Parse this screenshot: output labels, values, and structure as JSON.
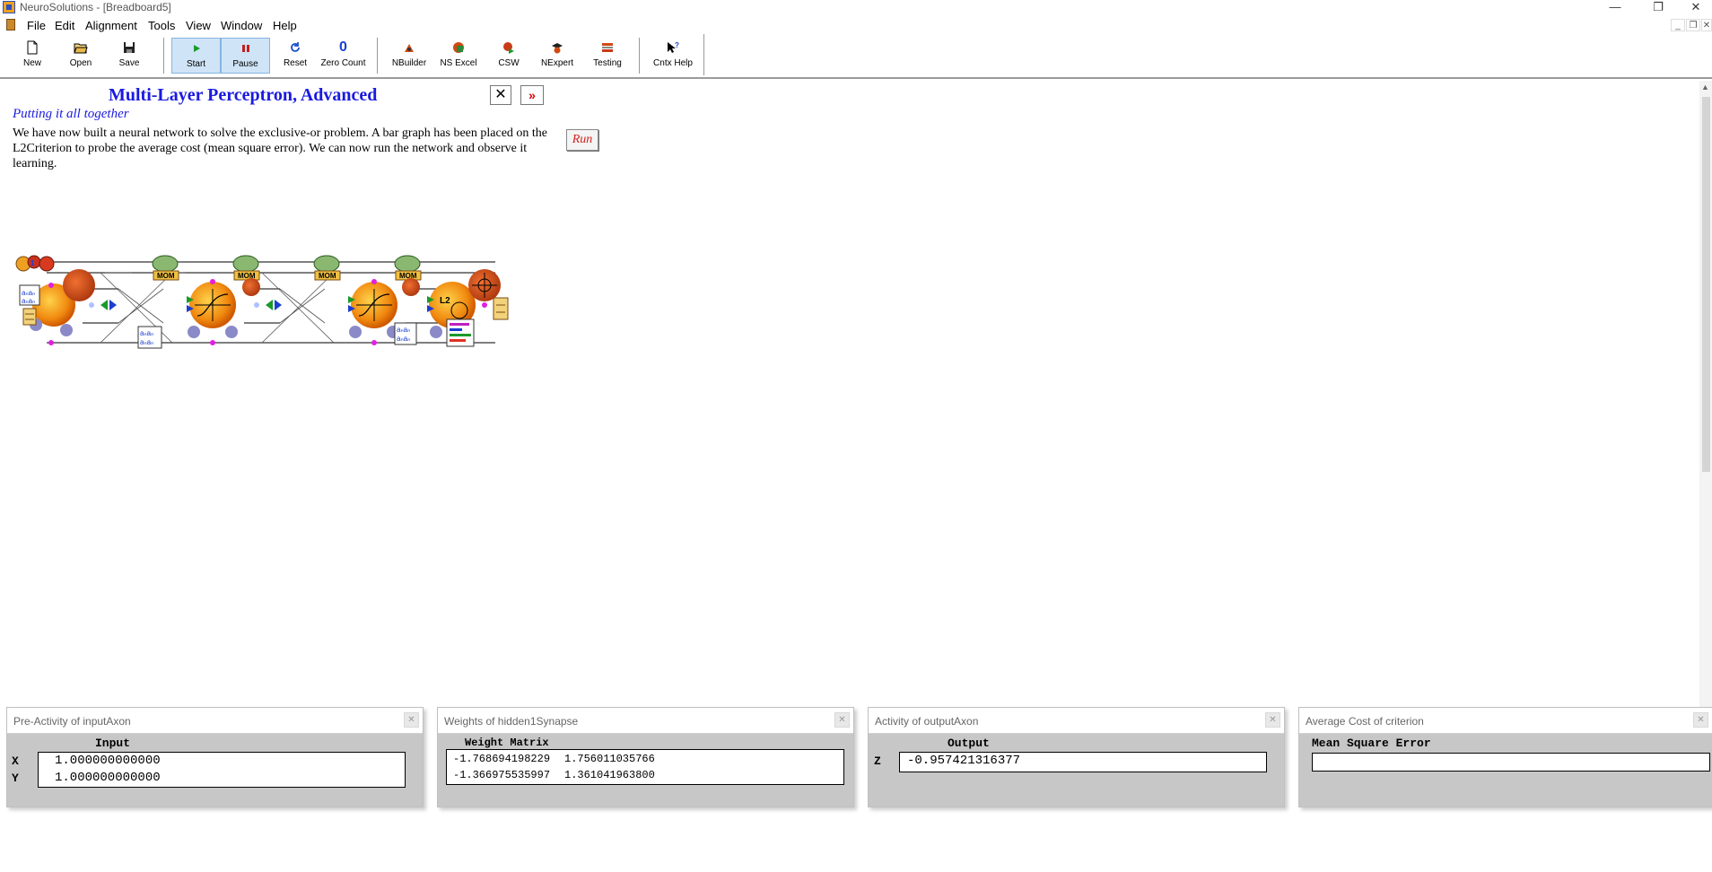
{
  "window": {
    "title": "NeuroSolutions - [Breadboard5]",
    "minimize": "—",
    "restore": "❐",
    "close": "✕"
  },
  "menu": {
    "items": [
      "File",
      "Edit",
      "Alignment",
      "Tools",
      "View",
      "Window",
      "Help"
    ]
  },
  "toolbar": {
    "buttons": [
      {
        "label": "New",
        "icon": "new-document-icon"
      },
      {
        "label": "Open",
        "icon": "open-folder-icon"
      },
      {
        "label": "Save",
        "icon": "save-disk-icon"
      },
      {
        "label": "Start",
        "icon": "play-icon"
      },
      {
        "label": "Pause",
        "icon": "pause-icon"
      },
      {
        "label": "Reset",
        "icon": "reset-icon"
      },
      {
        "label": "Zero Count",
        "icon": "zero-count-icon",
        "glyph": "0"
      },
      {
        "label": "NBuilder",
        "icon": "nbuilder-icon"
      },
      {
        "label": "NS Excel",
        "icon": "ns-excel-icon"
      },
      {
        "label": "CSW",
        "icon": "csw-icon"
      },
      {
        "label": "NExpert",
        "icon": "nexpert-icon"
      },
      {
        "label": "Testing",
        "icon": "testing-icon"
      },
      {
        "label": "Cntx Help",
        "icon": "context-help-icon"
      }
    ]
  },
  "document": {
    "title": "Multi-Layer Perceptron, Advanced",
    "subtitle": "Putting it all together",
    "body": "We have now built a neural network to solve the exclusive-or problem. A bar graph has been placed on the L2Criterion to probe the average cost (mean square error). We can now run the network and observe it learning.",
    "close_glyph": "✕",
    "next_glyph": "»",
    "run_label": "Run"
  },
  "network": {
    "mom_label": "MOM",
    "l2_label": "L2"
  },
  "probes": [
    {
      "title": "Pre-Activity of inputAxon",
      "column": "Input",
      "rows": [
        {
          "label": "X",
          "value": "1.000000000000"
        },
        {
          "label": "Y",
          "value": "1.000000000000"
        }
      ]
    },
    {
      "title": "Weights of hidden1Synapse",
      "column": "Weight Matrix",
      "rows": [
        {
          "c1": "-1.768694198229",
          "c2": "1.756011035766"
        },
        {
          "c1": "-1.366975535997",
          "c2": "1.361041963800"
        }
      ]
    },
    {
      "title": "Activity of outputAxon",
      "column": "Output",
      "rows": [
        {
          "label": "Z",
          "value": "-0.957421316377"
        }
      ]
    },
    {
      "title": "Average Cost of criterion",
      "column": "Mean Square Error",
      "rows": [
        {
          "value": ""
        }
      ]
    }
  ],
  "colors": {
    "title_blue": "#1a1ae0",
    "run_red": "#d02020",
    "pressed_bg": "#cfe4f7",
    "panel_gray": "#c7c7c7"
  }
}
